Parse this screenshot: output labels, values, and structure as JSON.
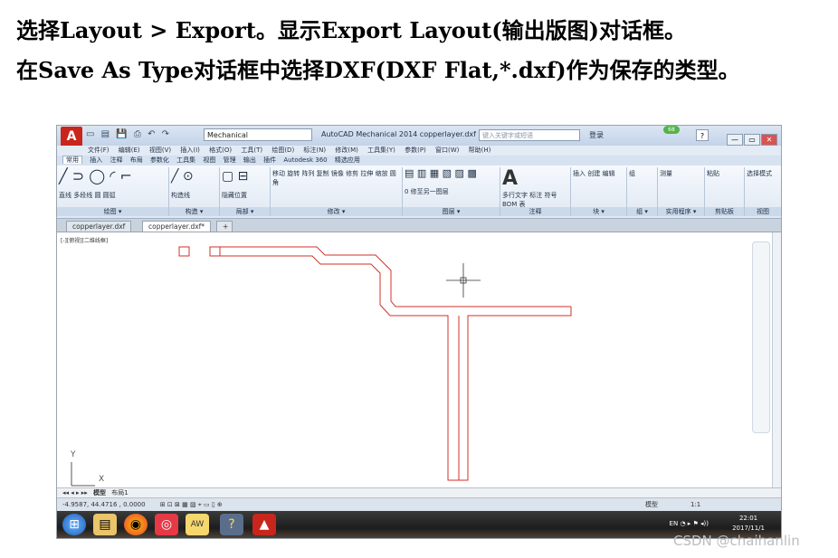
{
  "headings": {
    "line1": "选择Layout > Export。显示Export Layout(输出版图)对话框。",
    "line2": "在Save As Type对话框中选择DXF(DXF Flat,*.dxf)作为保存的类型。"
  },
  "window": {
    "workspace": "Mechanical",
    "title": "AutoCAD Mechanical 2014    copperlayer.dxf",
    "search_placeholder": "键入关键字或短语",
    "login": "登录",
    "help_badge": "68",
    "help": "?"
  },
  "menu": [
    "文件(F)",
    "编辑(E)",
    "视图(V)",
    "插入(I)",
    "格式(O)",
    "工具(T)",
    "绘图(D)",
    "标注(N)",
    "修改(M)",
    "工具集(Y)",
    "参数(P)",
    "窗口(W)",
    "帮助(H)"
  ],
  "ribbon_tabs": [
    "常用",
    "插入",
    "注释",
    "布局",
    "参数化",
    "工具集",
    "视图",
    "管理",
    "输出",
    "插件",
    "Autodesk 360",
    "精选应用"
  ],
  "ribbon_active_tab": "常用",
  "ribbon_groups": [
    {
      "label": "绘图 ▾",
      "tools": "直线  多段线  圆  圆弧"
    },
    {
      "label": "构造 ▾",
      "tools": "构造线"
    },
    {
      "label": "局部 ▾",
      "tools": "隐藏位置"
    },
    {
      "label": "修改 ▾",
      "tools": "移动 旋转 阵列 复制 镜像 修剪 拉伸 缩放 圆角"
    },
    {
      "label": "图层 ▾",
      "tools": "0  修至另一图层"
    },
    {
      "label": "注释",
      "tools": "多行文字 标注 符号 BOM 表"
    },
    {
      "label": "块 ▾",
      "tools": "插入 创建 编辑"
    },
    {
      "label": "组 ▾",
      "tools": "组"
    },
    {
      "label": "实用程序 ▾",
      "tools": "测量"
    },
    {
      "label": "剪贴板",
      "tools": "粘贴"
    },
    {
      "label": "视图",
      "tools": "选择模式"
    }
  ],
  "file_tabs": [
    {
      "name": "copperlayer.dxf"
    },
    {
      "name": "copperlayer.dxf*"
    }
  ],
  "view_label": "[-][俯视][二维线框]",
  "layout_tabs": [
    "模型",
    "布局1"
  ],
  "status": {
    "coords": "-4.9587,   44.4716  ,  0.0000",
    "model_label": "模型",
    "scale": "1:1"
  },
  "taskbar": {
    "time": "22:01",
    "date": "2017/11/1",
    "lang": "EN"
  },
  "watermark": "CSDN @chaihanlin"
}
